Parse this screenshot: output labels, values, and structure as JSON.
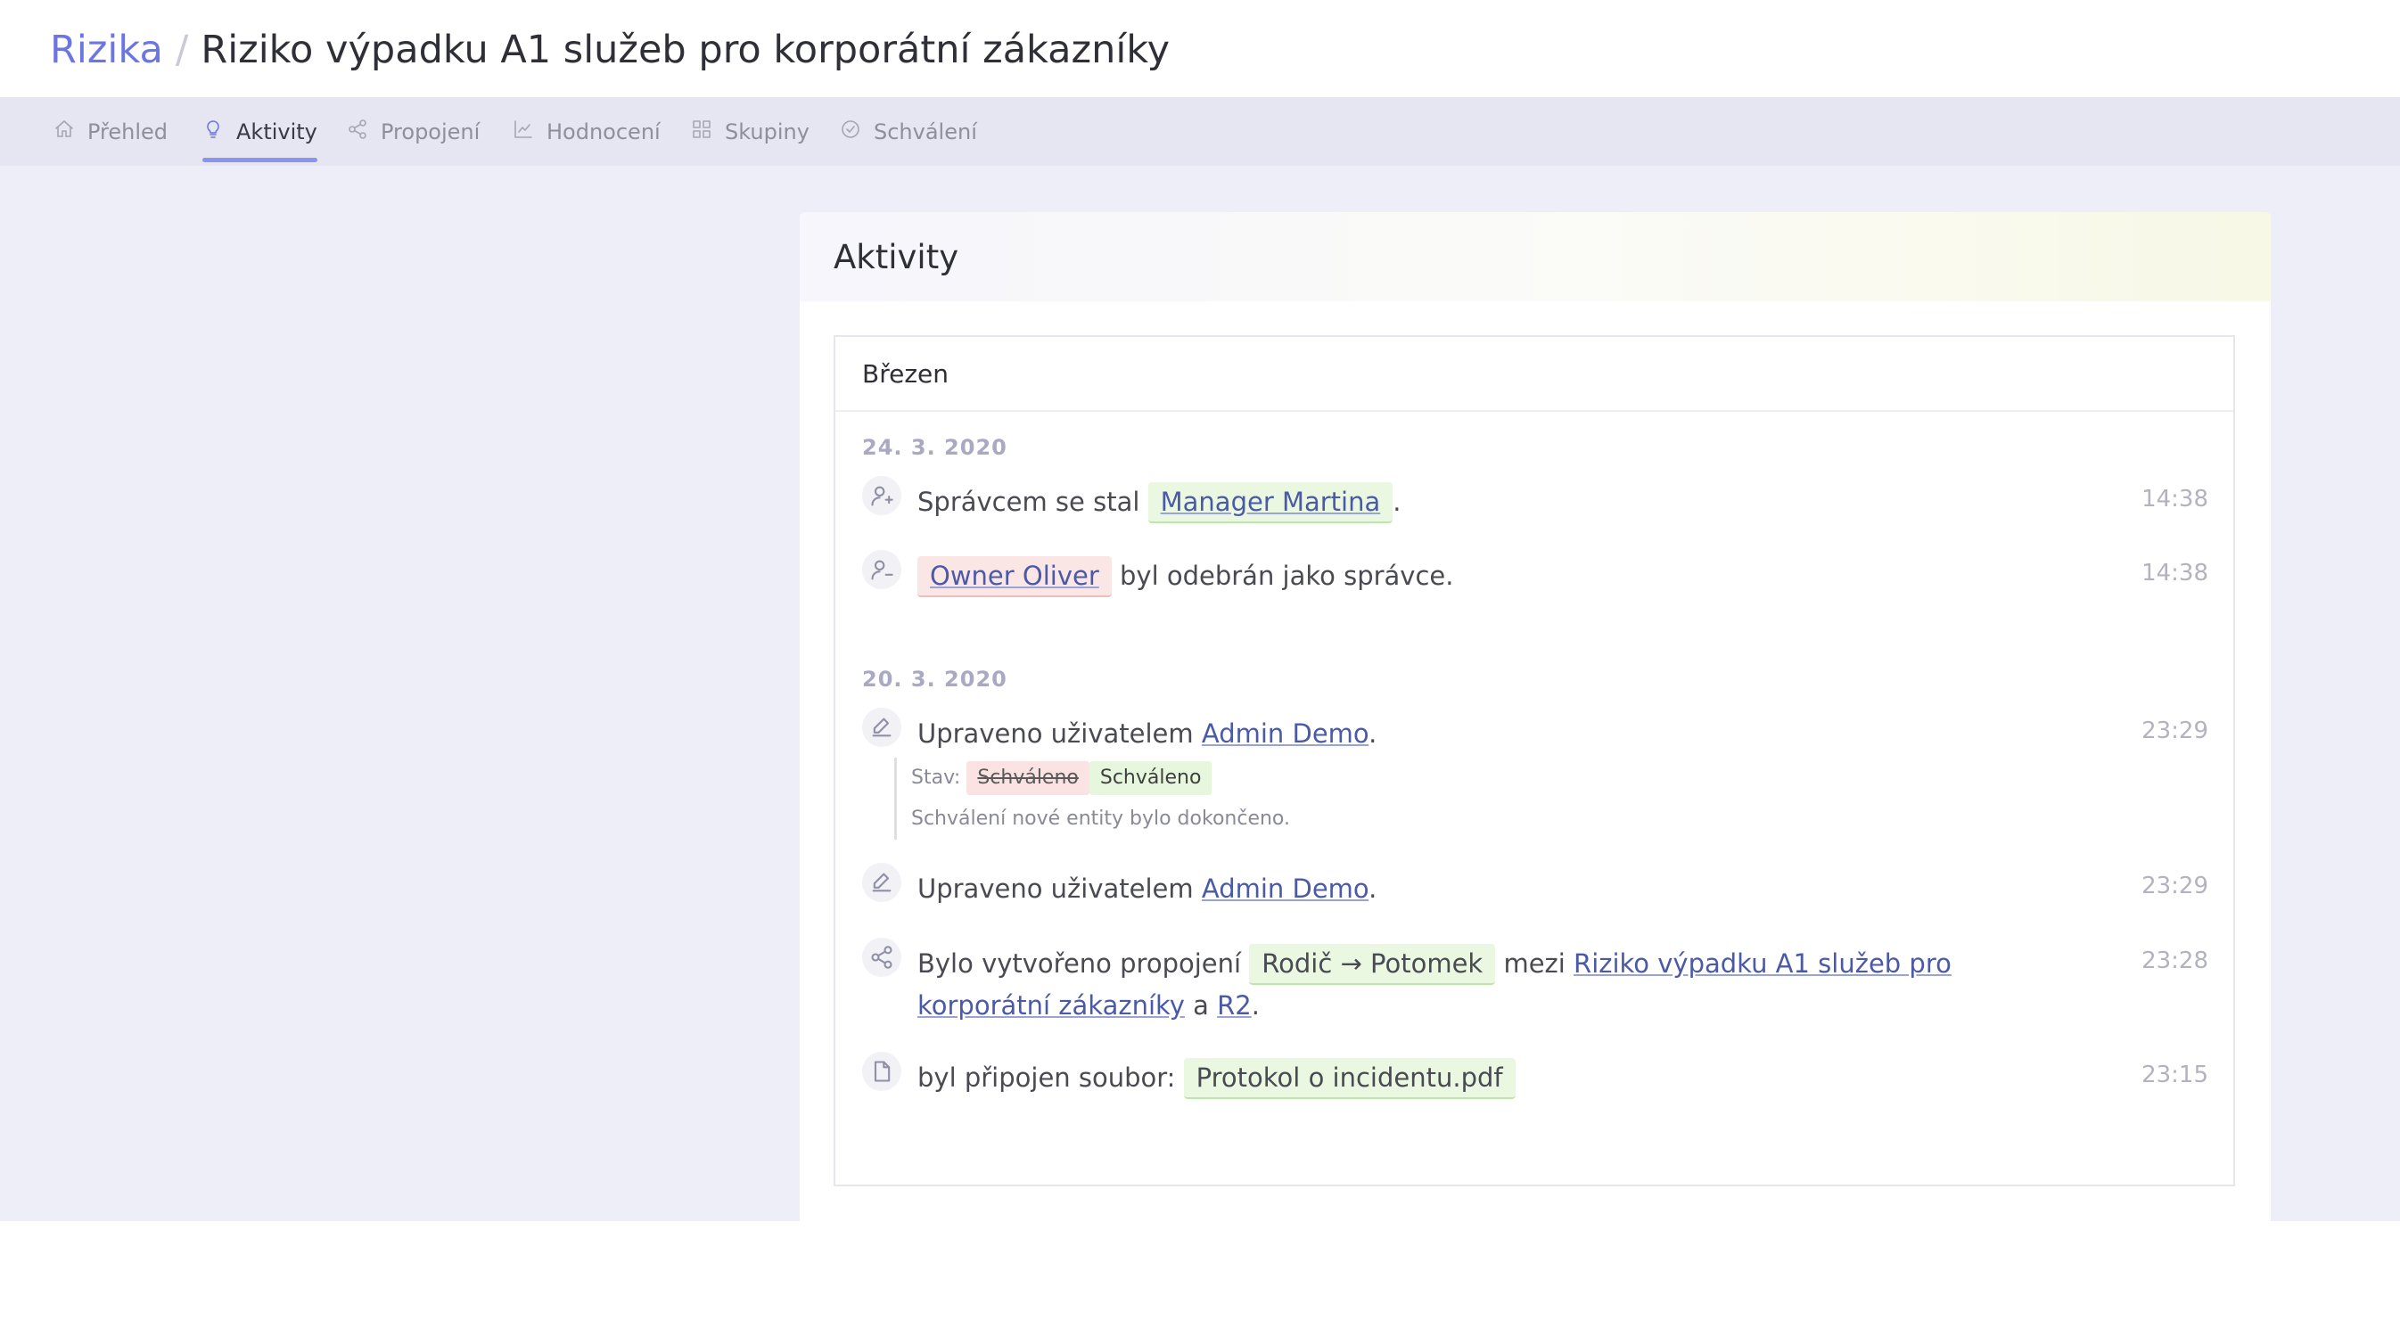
{
  "breadcrumb": {
    "root": "Rizika",
    "separator": "/",
    "title": "Riziko výpadku A1 služeb pro korporátní zákazníky"
  },
  "tabs": [
    {
      "label": "Přehled",
      "icon": "home-icon"
    },
    {
      "label": "Aktivity",
      "icon": "lightbulb-icon",
      "active": true
    },
    {
      "label": "Propojení",
      "icon": "share-icon"
    },
    {
      "label": "Hodnocení",
      "icon": "line-chart-icon"
    },
    {
      "label": "Skupiny",
      "icon": "grid-icon"
    },
    {
      "label": "Schválení",
      "icon": "check-circle-icon"
    }
  ],
  "card": {
    "title": "Aktivity"
  },
  "month": "Březen",
  "days": [
    {
      "date": "24. 3. 2020"
    },
    {
      "date": "20. 3. 2020"
    }
  ],
  "events": [
    {
      "icon": "user-add-icon",
      "time": "14:38",
      "prefix": "Správcem se stal",
      "chip": "Manager Martina",
      "suffix": "."
    },
    {
      "icon": "user-remove-icon",
      "time": "14:38",
      "chip": "Owner Oliver",
      "suffix": "byl odebrán jako správce."
    },
    {
      "icon": "edit-icon",
      "time": "23:29",
      "prefix": "Upraveno uživatelem",
      "link": "Admin Demo",
      "suffix": ".",
      "detail": {
        "label": "Stav:",
        "old": "Schváleno",
        "new": "Schváleno",
        "note": "Schválení nové entity bylo dokončeno."
      }
    },
    {
      "icon": "edit-icon",
      "time": "23:29",
      "prefix": "Upraveno uživatelem",
      "link": "Admin Demo",
      "suffix": "."
    },
    {
      "icon": "share-icon",
      "time": "23:28",
      "prefix": "Bylo vytvořeno propojení",
      "chip": "Rodič → Potomek",
      "mid": "mezi",
      "link": "Riziko výpadku A1 služeb pro korporátní zákazníky",
      "and": "a",
      "link2": "R2",
      "suffix": "."
    },
    {
      "icon": "file-icon",
      "time": "23:15",
      "prefix": "byl připojen soubor:",
      "chip": "Protokol o incidentu.pdf"
    }
  ],
  "colors": {
    "accent": "#6b76e3",
    "page_bg": "#eeeef8",
    "tabbar_bg": "#e6e6f2",
    "link": "#4b5aa8",
    "chip_green": "#eaf8e2",
    "chip_red": "#fbe6e6"
  }
}
